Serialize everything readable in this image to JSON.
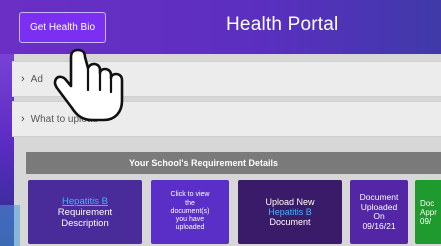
{
  "header": {
    "button_label": "Get Health Bio",
    "title": "Health Portal"
  },
  "panels": [
    {
      "label": "Ad"
    },
    {
      "label": "What to upload"
    }
  ],
  "requirements": {
    "bar_title": "Your School's Requirement Details",
    "cards": {
      "hepatitis": {
        "link": "Hepatitis B",
        "line1": "Requirement",
        "line2": "Description"
      },
      "view_docs": {
        "line1": "Click to view",
        "line2": "the",
        "line3": "document(s)",
        "line4": "you have",
        "line5": "uploaded"
      },
      "upload_new": {
        "line1": "Upload New",
        "link": "Hepatitis B",
        "line2": "Document"
      },
      "uploaded": {
        "line1": "Document",
        "line2": "Uploaded",
        "line3": "On",
        "line4": "09/16/21"
      },
      "approved": {
        "line1": "Doc",
        "line2": "Appr",
        "line3": "09/"
      }
    }
  },
  "colors": {
    "brand_purple": "#6a2bbf",
    "button_purple": "#7b2ff0",
    "link_blue": "#3fb4ff",
    "approved_green": "#1f9a2e"
  },
  "icons": {
    "cursor": "hand-pointer-icon",
    "chevron": "chevron-right-icon"
  }
}
